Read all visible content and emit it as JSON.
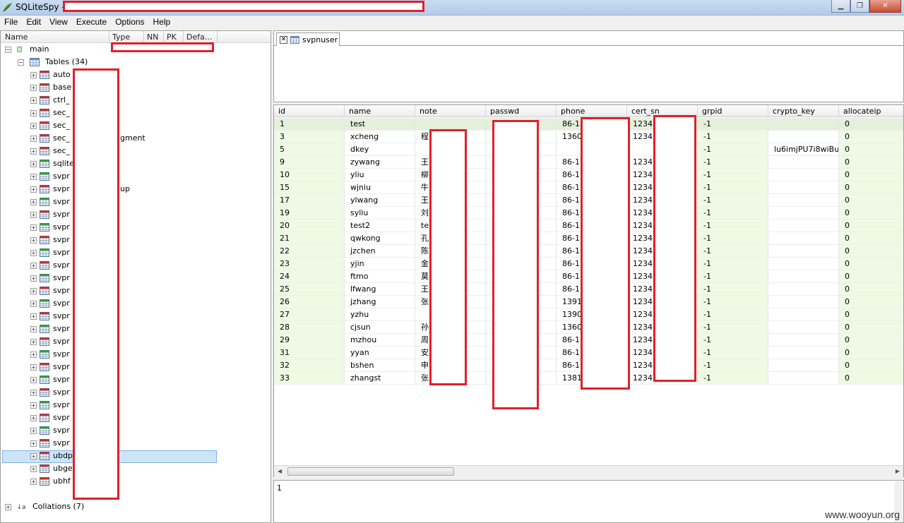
{
  "window": {
    "title": "SQLiteSpy -"
  },
  "menu": [
    "File",
    "Edit",
    "View",
    "Execute",
    "Options",
    "Help"
  ],
  "tree_columns": [
    "Name",
    "Type",
    "NN",
    "PK",
    "Defa..."
  ],
  "tree": {
    "root": "main",
    "tables_group": "Tables (34)",
    "tables": [
      "auto",
      "base",
      "ctrl_",
      "sec_",
      "sec_",
      "sec_",
      "sec_",
      "sqlite",
      "svpr",
      "svpr",
      "svpr",
      "svpr",
      "svpr",
      "svpr",
      "svpr",
      "svpr",
      "svpr",
      "svpr",
      "svpr",
      "svpr",
      "svpr",
      "svpr",
      "svpr",
      "svpr",
      "svpr",
      "svpr",
      "svpr",
      "svpr",
      "svpr",
      "svpr",
      "ubdp",
      "ubge",
      "ubhf"
    ],
    "table_suffixes": {
      "5": "gment",
      "9": "up"
    },
    "collations": "Collations (7)"
  },
  "tab": {
    "label": "svpnuser"
  },
  "grid": {
    "columns": [
      "id",
      "name",
      "note",
      "passwd",
      "phone",
      "cert_sn",
      "grpid",
      "crypto_key",
      "allocateip"
    ],
    "rows": [
      [
        "1",
        "test",
        "",
        "",
        "86-1",
        "12345",
        "-1",
        "",
        "0"
      ],
      [
        "3",
        "xcheng",
        "程",
        "",
        "1360",
        "12345",
        "-1",
        "",
        "0"
      ],
      [
        "5",
        "dkey",
        "",
        "",
        "",
        "",
        "-1",
        "lu6imjPU7i8wiBuf",
        "0"
      ],
      [
        "9",
        "zywang",
        "王",
        "",
        "86-1",
        "12345",
        "-1",
        "",
        "0"
      ],
      [
        "10",
        "yliu",
        "柳",
        "",
        "86-1",
        "12345",
        "-1",
        "",
        "0"
      ],
      [
        "15",
        "wjniu",
        "牛",
        "",
        "86-1",
        "12345",
        "-1",
        "",
        "0"
      ],
      [
        "17",
        "ylwang",
        "王",
        "",
        "86-1",
        "12345",
        "-1",
        "",
        "0"
      ],
      [
        "19",
        "syliu",
        "刘",
        "",
        "86-1",
        "12345",
        "-1",
        "",
        "0"
      ],
      [
        "20",
        "test2",
        "te",
        "",
        "86-1",
        "12345",
        "-1",
        "",
        "0"
      ],
      [
        "21",
        "qwkong",
        "孔",
        "",
        "86-1",
        "12345",
        "-1",
        "",
        "0"
      ],
      [
        "22",
        "jzchen",
        "陈",
        "",
        "86-1",
        "12345",
        "-1",
        "",
        "0"
      ],
      [
        "23",
        "yjin",
        "金",
        "",
        "86-1",
        "12345",
        "-1",
        "",
        "0"
      ],
      [
        "24",
        "ftmo",
        "莫",
        "",
        "86-1",
        "12345",
        "-1",
        "",
        "0"
      ],
      [
        "25",
        "lfwang",
        "王",
        "",
        "86-1",
        "12345",
        "-1",
        "",
        "0"
      ],
      [
        "26",
        "jzhang",
        "张",
        "",
        "1391",
        "12345",
        "-1",
        "",
        "0"
      ],
      [
        "27",
        "yzhu",
        "",
        "",
        "1390",
        "12345",
        "-1",
        "",
        "0"
      ],
      [
        "28",
        "cjsun",
        "孙",
        "",
        "1360",
        "12345",
        "-1",
        "",
        "0"
      ],
      [
        "29",
        "mzhou",
        "周",
        "",
        "86-1",
        "12345",
        "-1",
        "",
        "0"
      ],
      [
        "31",
        "yyan",
        "安",
        "",
        "86-1",
        "12345",
        "-1",
        "",
        "0"
      ],
      [
        "32",
        "bshen",
        "申",
        "",
        "86-1",
        "12345",
        "-1",
        "",
        "0"
      ],
      [
        "33",
        "zhangst",
        "张",
        "",
        "1381",
        "12345",
        "-1",
        "",
        "0"
      ]
    ]
  },
  "bottom": {
    "text": "1"
  },
  "watermark": "www.wooyun.org"
}
